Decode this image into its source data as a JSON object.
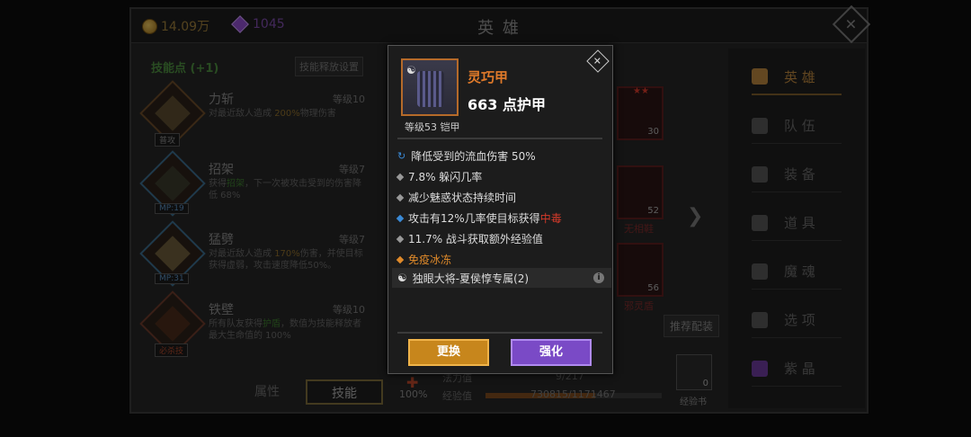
{
  "header": {
    "gold": "14.09万",
    "gems": "1045",
    "title": "英 雄",
    "close_icon": "close-icon"
  },
  "skills": {
    "title": "技能点 (+1)",
    "reset_label": "技能释放设置",
    "items": [
      {
        "name": "力斩",
        "level": "等级10",
        "tag": "普攻",
        "desc_pre": "对最近敌人造成 ",
        "desc_hl": "200%",
        "desc_post": "物理伤害"
      },
      {
        "name": "招架",
        "level": "等级7",
        "tag": "MP:19",
        "desc_pre": "获得",
        "desc_hl": "招架",
        "desc_post": "，下一次被攻击受到的伤害降低 68%"
      },
      {
        "name": "猛劈",
        "level": "等级7",
        "tag": "MP:31",
        "desc_pre": "对最近敌人造成 ",
        "desc_hl": "170%",
        "desc_post": "伤害，并使目标获得虚弱，攻击速度降低50%。"
      },
      {
        "name": "铁壁",
        "level": "等级10",
        "tag": "必杀技",
        "desc_pre": "所有队友获得",
        "desc_hl": "护盾",
        "desc_post": "，数值为技能释放者最大生命值的 100%"
      }
    ]
  },
  "bottom_tabs": {
    "attributes": "属性",
    "skills": "技能"
  },
  "nav": [
    {
      "label": "英 雄",
      "icon": "hero-icon"
    },
    {
      "label": "队 伍",
      "icon": "flag-icon"
    },
    {
      "label": "装 备",
      "icon": "helmet-icon"
    },
    {
      "label": "道 具",
      "icon": "bag-icon"
    },
    {
      "label": "魔 魂",
      "icon": "fire-icon"
    },
    {
      "label": "选 项",
      "icon": "gear-icon"
    },
    {
      "label": "紫 晶",
      "icon": "crystal-icon"
    }
  ],
  "equipment": {
    "slot1_count": "30",
    "slot2_count": "52",
    "slot2_name": "无相鞋",
    "slot3_count": "56",
    "slot3_name": "邪灵盾",
    "recommend_label": "推荐配装",
    "stat_mp_label": "法力值",
    "stat_mp_value": "9/217",
    "stat_xp_label": "经验值",
    "stat_xp_value": "730815/1171467",
    "stat_pct": "100%",
    "xp_book_label": "经验书",
    "xp_book_count": "0"
  },
  "popup": {
    "item_name": "灵巧甲",
    "armor": "663 点护甲",
    "level_type": "等级53 铠甲",
    "attributes": [
      {
        "text": "降低受到的流血伤害 50%"
      },
      {
        "text": "7.8% 躲闪几率"
      },
      {
        "text": "减少魅惑状态持续时间"
      },
      {
        "pre": "攻击有12%几率使目标获得",
        "hl": "中毒"
      },
      {
        "text": "11.7% 战斗获取额外经验值"
      },
      {
        "text": "免疫冰冻"
      }
    ],
    "set_bonus": "独眼大将-夏侯惇专属(2)",
    "replace_label": "更换",
    "upgrade_label": "强化"
  }
}
